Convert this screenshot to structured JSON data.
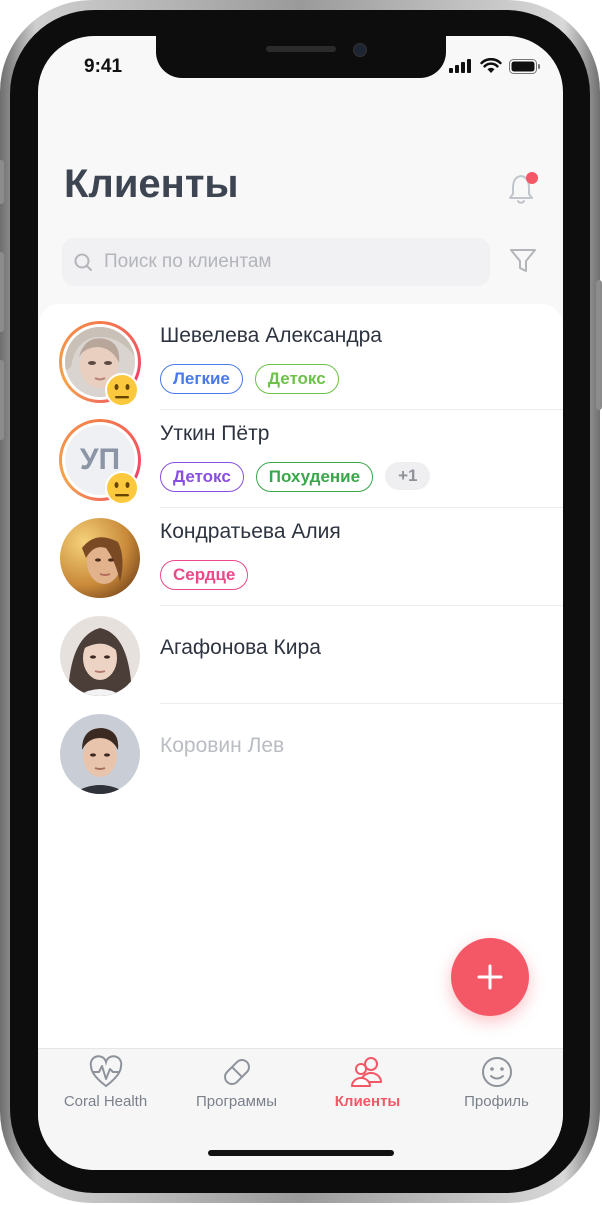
{
  "status_bar": {
    "time": "9:41"
  },
  "header": {
    "title": "Клиенты",
    "has_notification": true
  },
  "search": {
    "placeholder": "Поиск по клиентам",
    "value": ""
  },
  "clients": [
    {
      "name": "Шевелева Александра",
      "avatar": "photo",
      "emoji": "neutral-face-icon",
      "tags": [
        {
          "label": "Легкие",
          "color": "#4a79e8"
        },
        {
          "label": "Детокс",
          "color": "#6cc24a"
        }
      ]
    },
    {
      "name": "Уткин Пётр",
      "avatar": "initials",
      "initials": "УП",
      "emoji": "neutral-face-icon",
      "tags": [
        {
          "label": "Детокс",
          "color": "#8a4ee0"
        },
        {
          "label": "Похудение",
          "color": "#3aa64a"
        }
      ],
      "more": "+1"
    },
    {
      "name": "Кондратьева Алия",
      "avatar": "photo",
      "tags": [
        {
          "label": "Сердце",
          "color": "#ea4a8a"
        }
      ]
    },
    {
      "name": "Агафонова Кира",
      "avatar": "photo",
      "tags": []
    },
    {
      "name": "Коровин Лев",
      "avatar": "photo",
      "tags": [],
      "muted": true
    }
  ],
  "fab": {
    "icon": "plus-icon"
  },
  "tabbar": {
    "items": [
      {
        "label": "Coral Health",
        "icon": "heart-pulse-icon",
        "active": false
      },
      {
        "label": "Программы",
        "icon": "pill-icon",
        "active": false
      },
      {
        "label": "Клиенты",
        "icon": "users-icon",
        "active": true
      },
      {
        "label": "Профиль",
        "icon": "smile-icon",
        "active": false
      }
    ]
  },
  "colors": {
    "accent": "#f45866",
    "title": "#3d4552",
    "text": "#2d3440"
  }
}
